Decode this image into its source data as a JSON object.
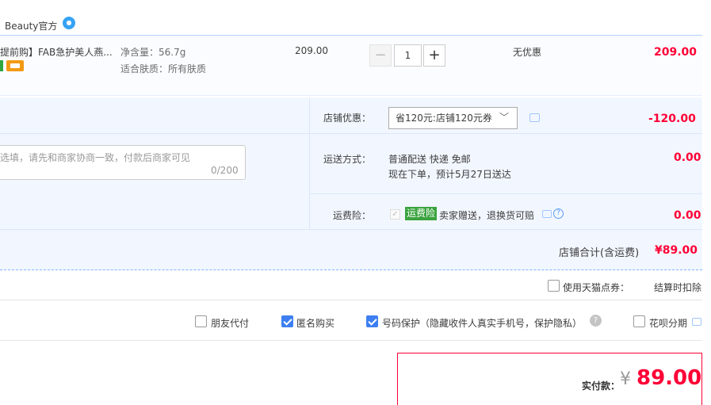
{
  "shop": {
    "name": "Beauty官方",
    "chat_icon": "wangwang-chat-icon"
  },
  "item": {
    "title": "提前购】FAB急护美人燕...",
    "sku_weight": "净含量：56.7g",
    "sku_skin": "适合肤质：所有肤质",
    "unit_price": "209.00",
    "quantity": "1",
    "minus": "−",
    "plus": "+",
    "discount": "无优惠",
    "total": "209.00"
  },
  "order_extras": {
    "shop_discount_label": "店铺优惠：",
    "coupon_selected": "省120元:店铺120元券",
    "discount_amount": "-120.00",
    "memo_placeholder": "选填，请先和商家协商一致，付款后商家可见",
    "memo_count": "0/200",
    "shipping_label": "运送方式：",
    "shipping_method": "普通配送 快递 免邮",
    "shipping_eta": "现在下单，预计5月27日送达",
    "shipping_amount": "0.00",
    "insurance_label": "运费险：",
    "insurance_tag": "运费险",
    "insurance_desc": "卖家赠送，退换货可赔",
    "insurance_amount": "0.00",
    "shop_total_label": "店铺合计(含运费)",
    "shop_total_amount": "¥89.00"
  },
  "tmall": {
    "use_coupon_label": "使用天猫点券：",
    "deduct_label": "结算时扣除"
  },
  "options": {
    "friend_pay": "朋友代付",
    "anonymous": "匿名购买",
    "phone_protect": "号码保护（隐藏收件人真实手机号，保护隐私）",
    "huabei": "花呗分期"
  },
  "payment": {
    "label": "实付款：",
    "currency": "¥",
    "amount": "89.00"
  },
  "colors": {
    "accent_red": "#ff0036",
    "border_blue": "#b2d1ff",
    "insurance_green": "#3aa33e"
  }
}
